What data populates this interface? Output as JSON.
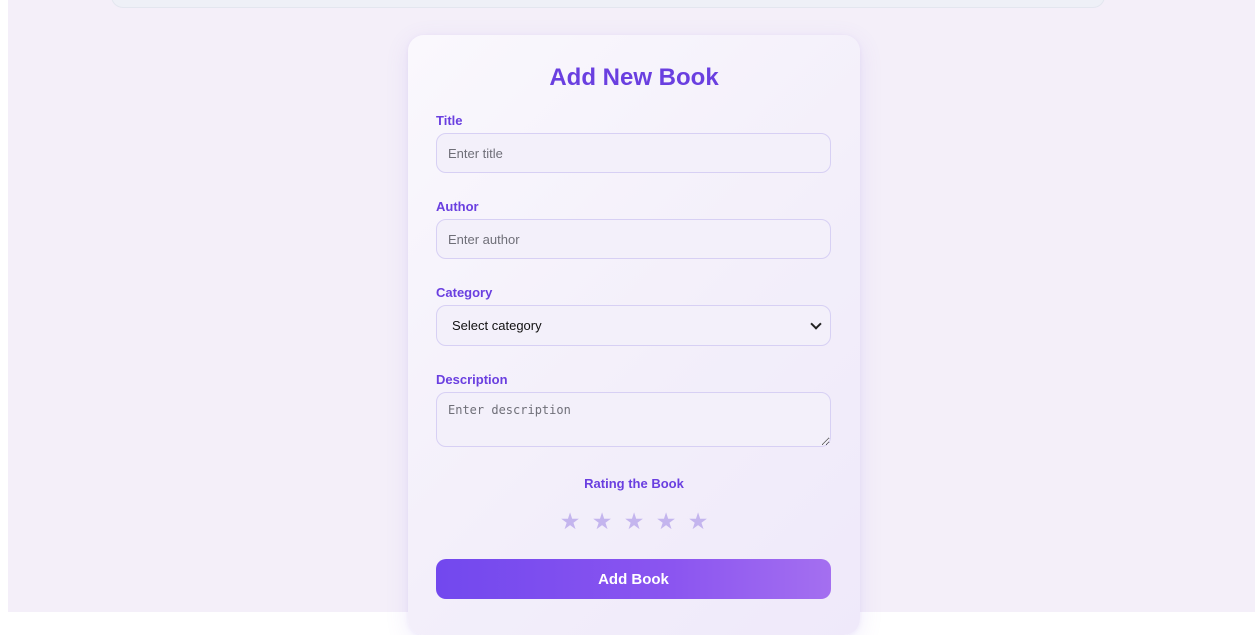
{
  "form": {
    "heading": "Add New Book",
    "title_field": {
      "label": "Title",
      "placeholder": "Enter title",
      "value": ""
    },
    "author_field": {
      "label": "Author",
      "placeholder": "Enter author",
      "value": ""
    },
    "category_field": {
      "label": "Category",
      "selected": "Select category"
    },
    "description_field": {
      "label": "Description",
      "placeholder": "Enter description",
      "value": ""
    },
    "rating": {
      "label": "Rating the Book",
      "max": 5,
      "value": 0,
      "star_glyph": "★"
    },
    "submit_label": "Add Book"
  },
  "colors": {
    "accent": "#6a3fe0",
    "background": "#f4eff9",
    "star_inactive": "#c4b5ee",
    "button_gradient_start": "#7248ee",
    "button_gradient_end": "#a46ff0"
  }
}
